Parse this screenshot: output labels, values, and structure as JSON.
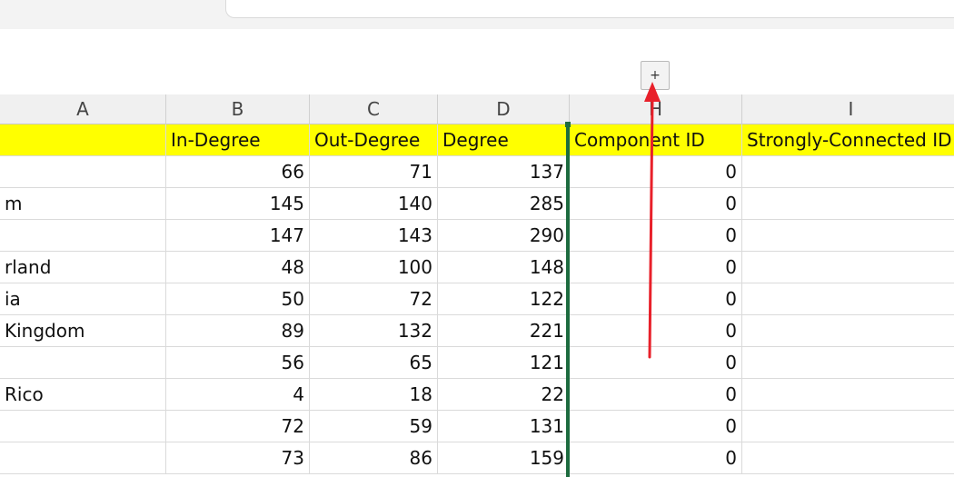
{
  "toolbar": {
    "add_label": "+"
  },
  "columns": [
    "A",
    "B",
    "C",
    "D",
    "H",
    "I"
  ],
  "header_row": [
    "",
    "In-Degree",
    "Out-Degree",
    "Degree",
    "Component ID",
    "Strongly-Connected ID"
  ],
  "rows": [
    [
      "",
      "66",
      "71",
      "137",
      "0",
      ""
    ],
    [
      "m",
      "145",
      "140",
      "285",
      "0",
      ""
    ],
    [
      "",
      "147",
      "143",
      "290",
      "0",
      ""
    ],
    [
      "rland",
      "48",
      "100",
      "148",
      "0",
      ""
    ],
    [
      "ia",
      "50",
      "72",
      "122",
      "0",
      ""
    ],
    [
      " Kingdom",
      "89",
      "132",
      "221",
      "0",
      ""
    ],
    [
      "",
      "56",
      "65",
      "121",
      "0",
      ""
    ],
    [
      " Rico",
      "4",
      "18",
      "22",
      "0",
      ""
    ],
    [
      "",
      "72",
      "59",
      "131",
      "0",
      ""
    ],
    [
      "",
      "73",
      "86",
      "159",
      "0",
      ""
    ]
  ],
  "colors": {
    "header_highlight": "#ffff00",
    "annotation_arrow": "#e8202a",
    "freeze_line": "#1d6b3f"
  }
}
